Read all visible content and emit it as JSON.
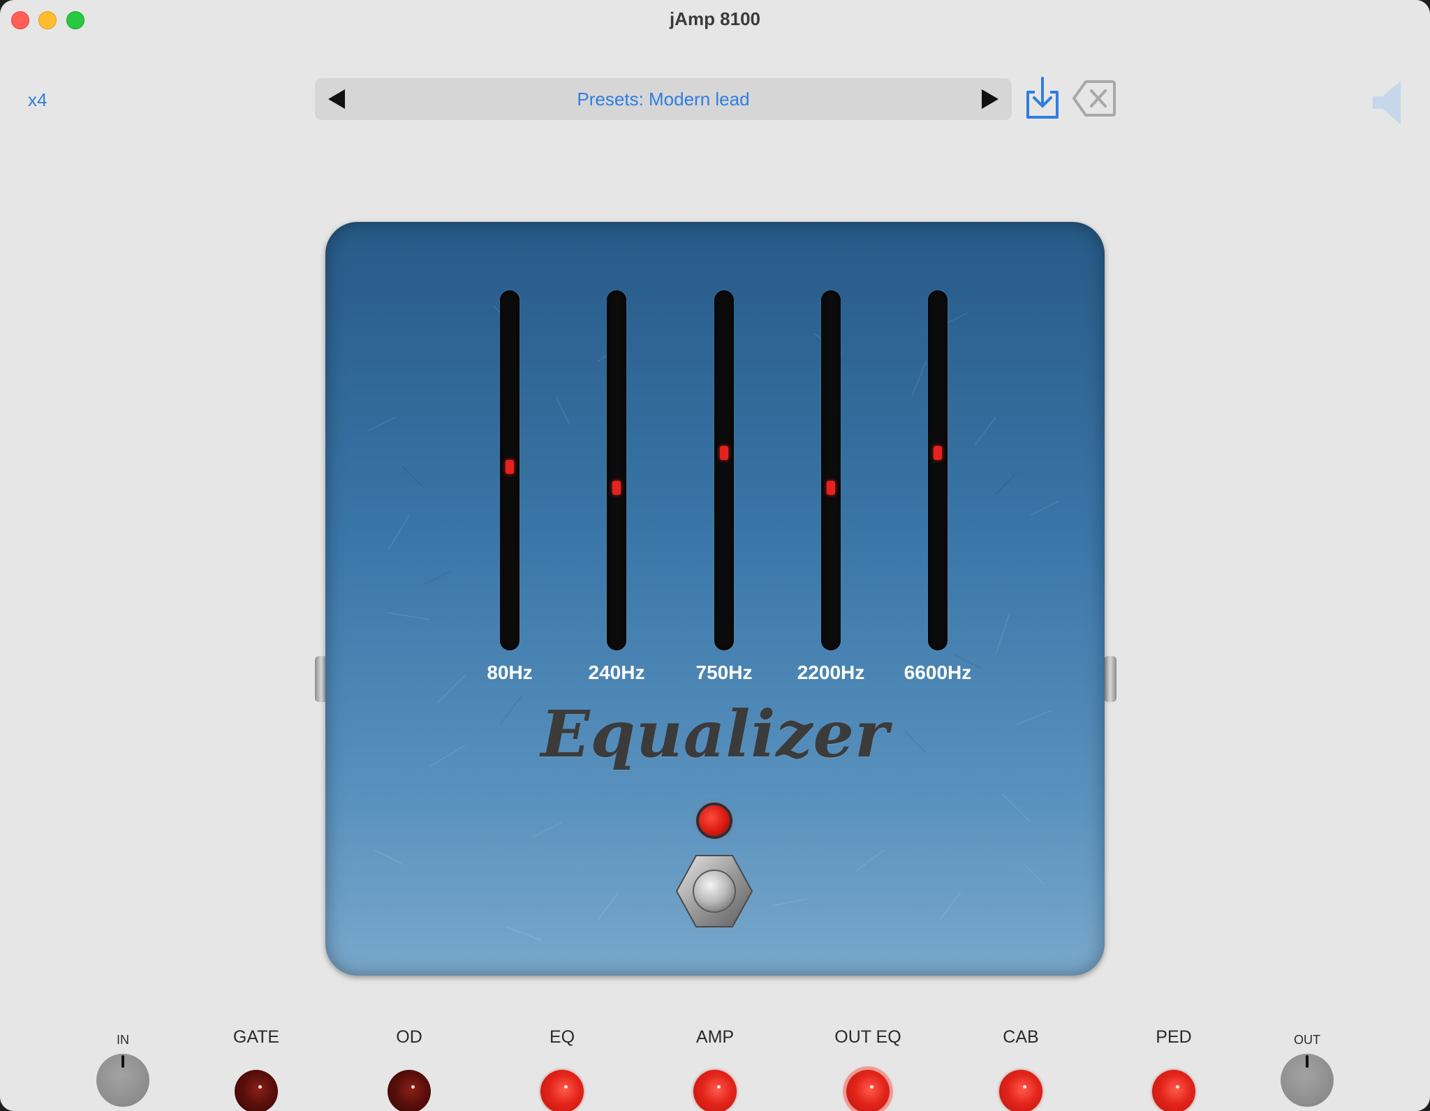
{
  "window": {
    "title": "jAmp 8100"
  },
  "toolbar": {
    "multiplier": "x4",
    "preset_label": "Presets: Modern lead",
    "save_icon": "save-download-icon",
    "delete_icon": "delete-backspace-icon",
    "speaker_icon": "speaker-icon",
    "accent_color": "#2f7de1"
  },
  "pedal": {
    "name": "Equalizer",
    "color": "#3a76a8",
    "led_on": true,
    "bands": [
      {
        "label": "80Hz",
        "level": 0.51
      },
      {
        "label": "240Hz",
        "level": 0.45
      },
      {
        "label": "750Hz",
        "level": 0.55
      },
      {
        "label": "2200Hz",
        "level": 0.45
      },
      {
        "label": "6600Hz",
        "level": 0.55
      }
    ]
  },
  "chain": {
    "in_label": "IN",
    "out_label": "OUT",
    "modules": [
      {
        "label": "GATE",
        "on": false
      },
      {
        "label": "OD",
        "on": false
      },
      {
        "label": "EQ",
        "on": true
      },
      {
        "label": "AMP",
        "on": true
      },
      {
        "label": "OUT EQ",
        "on": true,
        "selected": true
      },
      {
        "label": "CAB",
        "on": true
      },
      {
        "label": "PED",
        "on": true
      }
    ]
  }
}
